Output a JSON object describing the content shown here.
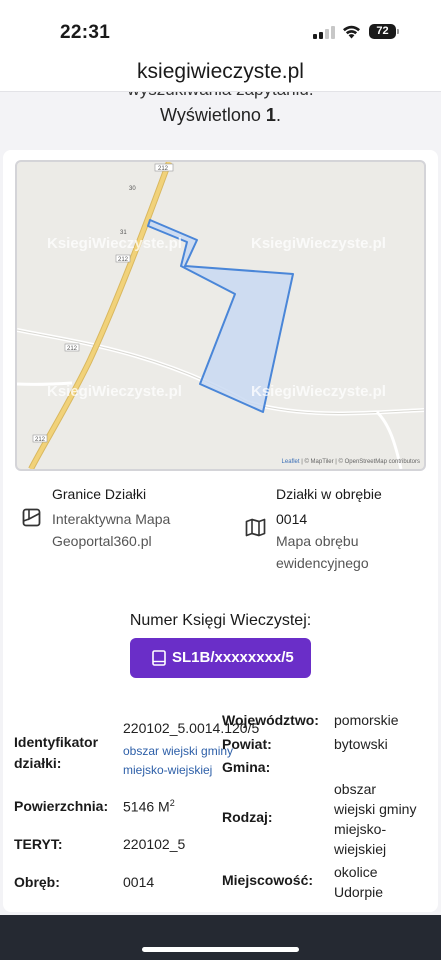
{
  "status_bar": {
    "time": "22:31",
    "battery": "72"
  },
  "browser": {
    "url": "ksiegiwieczyste.pl"
  },
  "header": {
    "partial_text": "wyszukiwania zapytaniu.",
    "shown_label": "Wyświetlono",
    "shown_count": "1"
  },
  "map": {
    "watermark": "KsiegiWieczyste.pl",
    "road_labels": [
      "212",
      "212",
      "212",
      "212"
    ],
    "place_labels": [
      "30",
      "31"
    ],
    "attribution": {
      "leaflet": "Leaflet",
      "rest": " | © MapTiler | © OpenStreetMap contributors"
    }
  },
  "links": {
    "boundaries": {
      "title": "Granice Działki",
      "line1": "Interaktywna Mapa",
      "line2": "Geoportal360.pl"
    },
    "district": {
      "title": "Działki w obrębie",
      "number": "0014",
      "line1": "Mapa obrębu",
      "line2": "ewidencyjnego"
    }
  },
  "land_register": {
    "label": "Numer Księgi Wieczystej:",
    "button": "SL1B/xxxxxxxx/5"
  },
  "details": {
    "left": {
      "identifier_label_1": "Identyfikator",
      "identifier_label_2": "działki:",
      "identifier_value": "220102_5.0014.120/5",
      "identifier_sub_1": "obszar wiejski gminy",
      "identifier_sub_2": "miejsko-wiejskiej",
      "area_label": "Powierzchnia:",
      "area_value": "5146 M",
      "area_exp": "2",
      "teryt_label": "TERYT:",
      "teryt_value": "220102_5",
      "precinct_label": "Obręb:",
      "precinct_value": "0014"
    },
    "right": {
      "voivodeship_label": "Województwo:",
      "voivodeship_value": "pomorskie",
      "county_label": "Powiat:",
      "county_value": "bytowski",
      "commune_label": "Gmina:",
      "type_label": "Rodzaj:",
      "type_value_1": "obszar",
      "type_value_2": "wiejski gminy",
      "type_value_3": "miejsko-",
      "type_value_4": "wiejskiej",
      "locality_label": "Miejscowość:",
      "locality_value_1": "okolice",
      "locality_value_2": "Udorpie"
    }
  },
  "colors": {
    "accent": "#6a2ec8",
    "link": "#2d5fa8",
    "parcel_fill": "#c9d9f2",
    "parcel_stroke": "#4a86d8",
    "road": "#f1d27a"
  }
}
